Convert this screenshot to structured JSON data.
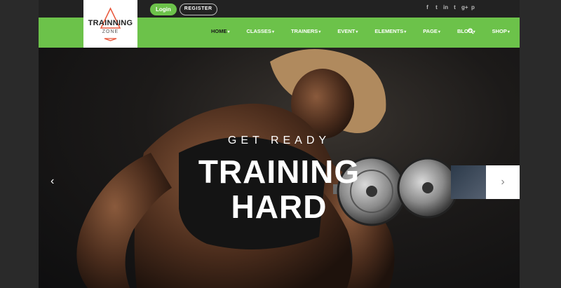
{
  "brand": {
    "line1": "TRAINNING",
    "line2": "ZONE",
    "accent": "#e8563a"
  },
  "auth": {
    "login_label": "Login",
    "register_label": "REGISTER"
  },
  "social": {
    "icons": [
      "f",
      "t",
      "in",
      "t",
      "g+",
      "p"
    ]
  },
  "nav": {
    "items": [
      {
        "label": "HOME",
        "active": true
      },
      {
        "label": "CLASSES"
      },
      {
        "label": "TRAINERS"
      },
      {
        "label": "EVENT"
      },
      {
        "label": "ELEMENTS"
      },
      {
        "label": "PAGE"
      },
      {
        "label": "BLOG"
      },
      {
        "label": "SHOP"
      }
    ],
    "caret": "▾"
  },
  "hero": {
    "kicker": "GET READY",
    "title_line1": "TRAINING",
    "title_line2": "HARD"
  },
  "slider": {
    "prev_icon": "‹",
    "next_icon": "›"
  },
  "colors": {
    "green": "#6cc24a",
    "dark": "#222222"
  }
}
